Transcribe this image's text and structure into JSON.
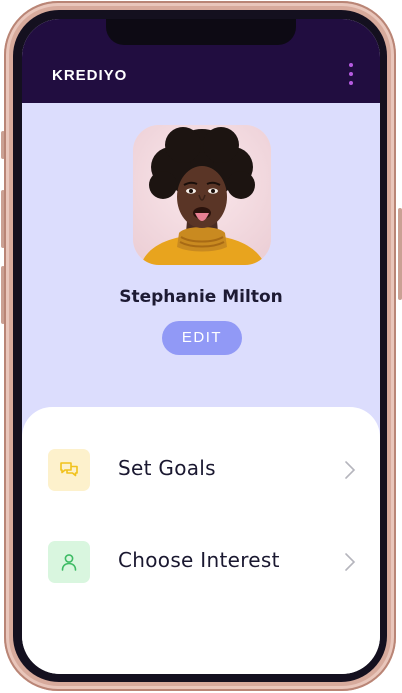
{
  "header": {
    "brand": "KREDIYO"
  },
  "profile": {
    "name": "Stephanie Milton",
    "edit_label": "EDIT"
  },
  "menu": {
    "items": [
      {
        "label": "Set Goals",
        "icon": "chat-bubbles-icon",
        "icon_color": "#f1c21b",
        "icon_bg": "#fdf1cc"
      },
      {
        "label": "Choose Interest",
        "icon": "user-icon",
        "icon_color": "#3dbb64",
        "icon_bg": "#d9f6df"
      }
    ]
  },
  "colors": {
    "header_bg": "#210d40",
    "profile_bg": "#dcddfd",
    "edit_button": "#9199f6",
    "more_dots": "#b65be0"
  }
}
